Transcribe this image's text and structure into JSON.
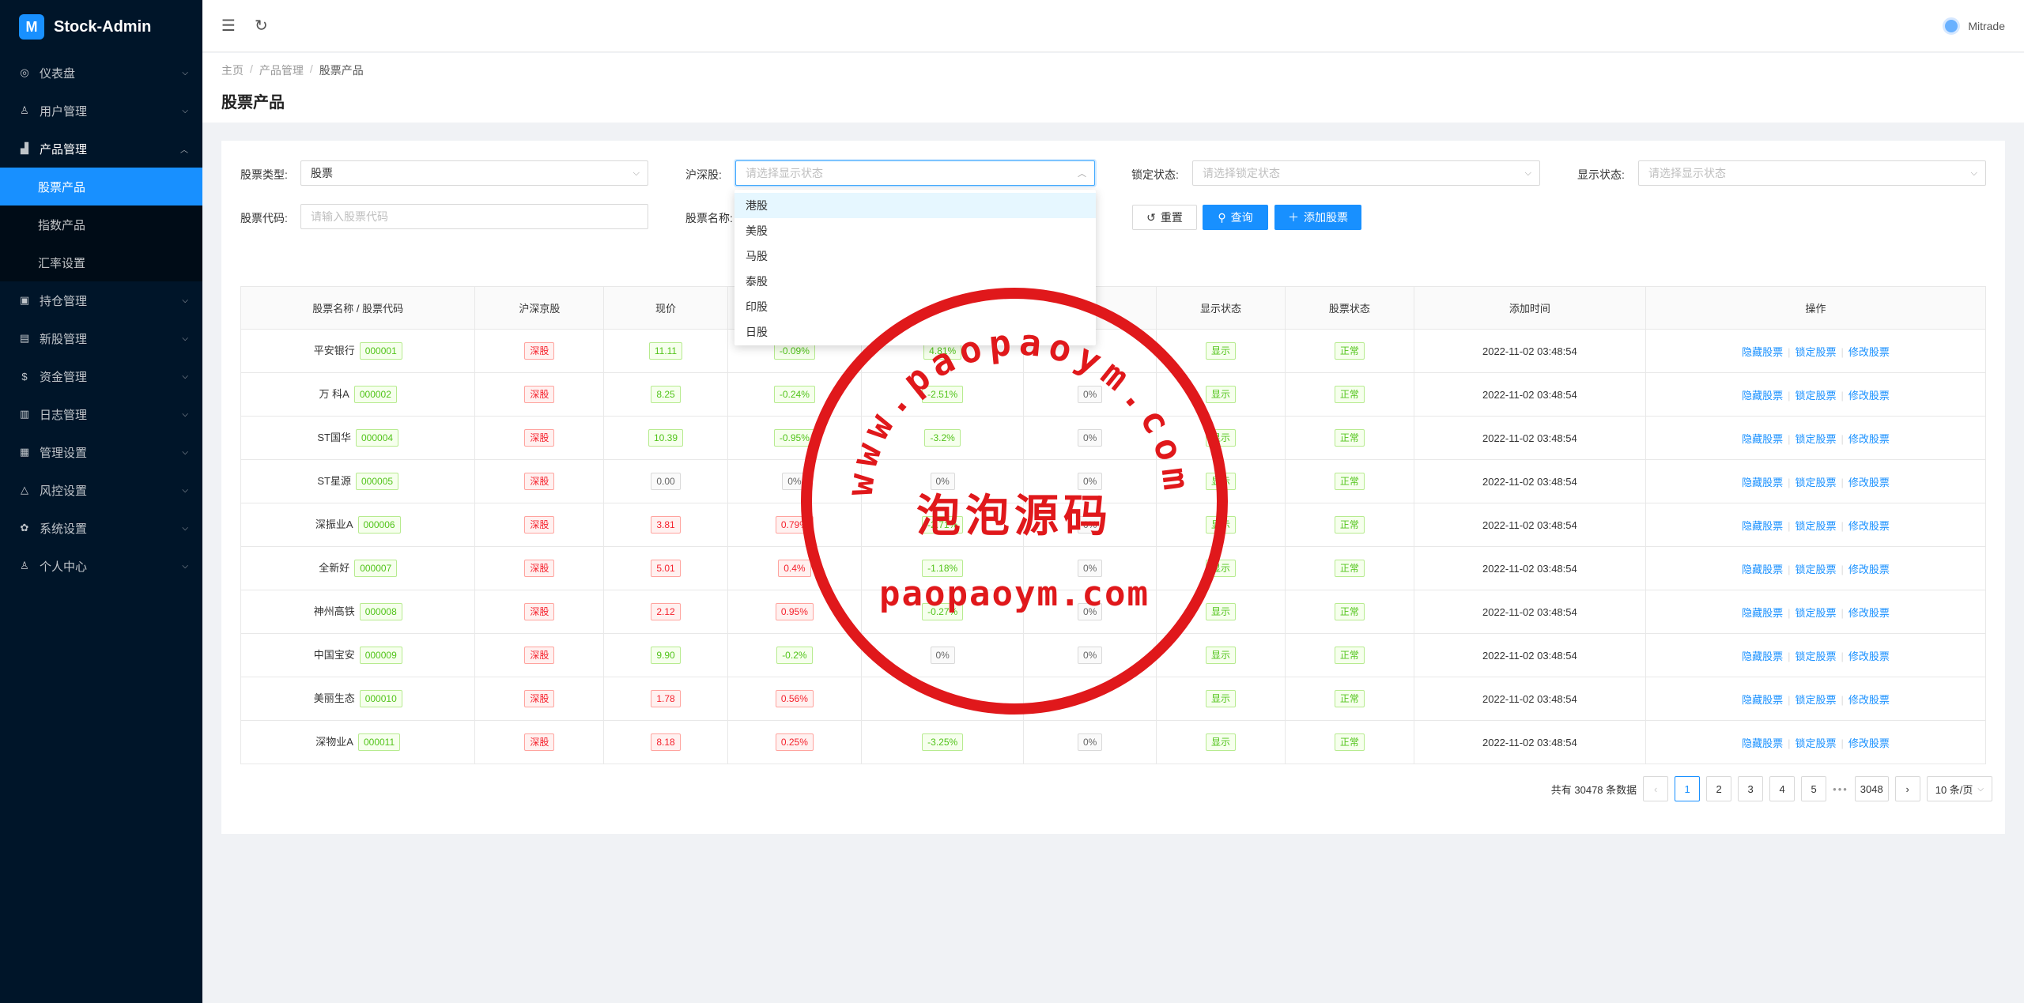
{
  "app": {
    "logo_letter": "M",
    "name": "Stock-Admin"
  },
  "sidebar": {
    "items": [
      {
        "icon": "dashboard-icon",
        "glyph": "◎",
        "label": "仪表盘"
      },
      {
        "icon": "users-icon",
        "glyph": "♙",
        "label": "用户管理"
      },
      {
        "icon": "chart-icon",
        "glyph": "▟",
        "label": "产品管理",
        "open": true
      },
      {
        "icon": "holdings-icon",
        "glyph": "▣",
        "label": "持仓管理"
      },
      {
        "icon": "ipo-icon",
        "glyph": "▤",
        "label": "新股管理"
      },
      {
        "icon": "funds-icon",
        "glyph": "$",
        "label": "资金管理"
      },
      {
        "icon": "log-icon",
        "glyph": "▥",
        "label": "日志管理"
      },
      {
        "icon": "admin-icon",
        "glyph": "▦",
        "label": "管理设置"
      },
      {
        "icon": "risk-icon",
        "glyph": "△",
        "label": "风控设置"
      },
      {
        "icon": "settings-icon",
        "glyph": "✿",
        "label": "系统设置"
      },
      {
        "icon": "profile-icon",
        "glyph": "♙",
        "label": "个人中心"
      }
    ],
    "sub_items": [
      "股票产品",
      "指数产品",
      "汇率设置"
    ]
  },
  "header": {
    "user": "Mitrade"
  },
  "breadcrumb": [
    "主页",
    "产品管理",
    "股票产品"
  ],
  "page_title": "股票产品",
  "filters": {
    "stock_type_label": "股票类型:",
    "stock_type_value": "股票",
    "market_label": "沪深股:",
    "market_placeholder": "请选择显示状态",
    "lock_label": "锁定状态:",
    "lock_placeholder": "请选择锁定状态",
    "display_label": "显示状态:",
    "display_placeholder": "请选择显示状态",
    "code_label": "股票代码:",
    "code_placeholder": "请输入股票代码",
    "name_label": "股票名称:",
    "reset": "重置",
    "search": "查询",
    "add": "添加股票"
  },
  "dropdown_options": [
    "港股",
    "美股",
    "马股",
    "泰股",
    "印股",
    "日股"
  ],
  "table": {
    "headers": [
      "股票名称 / 股票代码",
      "沪深京股",
      "现价",
      "",
      "",
      "率",
      "显示状态",
      "股票状态",
      "添加时间",
      "操作"
    ],
    "actions": [
      "隐藏股票",
      "锁定股票",
      "修改股票"
    ],
    "rows": [
      {
        "name": "平安银行",
        "code": "000001",
        "market": "深股",
        "price": "11.11",
        "price_c": "green",
        "c1": "-0.09%",
        "c1_c": "green",
        "c2": "4.81%",
        "c2_c": "green",
        "c3": "",
        "show": "显示",
        "status": "正常",
        "time": "2022-11-02 03:48:54"
      },
      {
        "name": "万 科A",
        "code": "000002",
        "market": "深股",
        "price": "8.25",
        "price_c": "green",
        "c1": "-0.24%",
        "c1_c": "green",
        "c2": "-2.51%",
        "c2_c": "green",
        "c3": "0%",
        "show": "显示",
        "status": "正常",
        "time": "2022-11-02 03:48:54"
      },
      {
        "name": "ST国华",
        "code": "000004",
        "market": "深股",
        "price": "10.39",
        "price_c": "green",
        "c1": "-0.95%",
        "c1_c": "green",
        "c2": "-3.2%",
        "c2_c": "green",
        "c3": "0%",
        "show": "显示",
        "status": "正常",
        "time": "2022-11-02 03:48:54"
      },
      {
        "name": "ST星源",
        "code": "000005",
        "market": "深股",
        "price": "0.00",
        "price_c": "grey",
        "c1": "0%",
        "c1_c": "grey",
        "c2": "0%",
        "c2_c": "grey",
        "c3": "0%",
        "show": "显示",
        "status": "正常",
        "time": "2022-11-02 03:48:54"
      },
      {
        "name": "深振业A",
        "code": "000006",
        "market": "深股",
        "price": "3.81",
        "price_c": "red",
        "c1": "0.79%",
        "c1_c": "red",
        "c2": "-2.71%",
        "c2_c": "green",
        "c3": "0%",
        "show": "显示",
        "status": "正常",
        "time": "2022-11-02 03:48:54"
      },
      {
        "name": "全新好",
        "code": "000007",
        "market": "深股",
        "price": "5.01",
        "price_c": "red",
        "c1": "0.4%",
        "c1_c": "red",
        "c2": "-1.18%",
        "c2_c": "green",
        "c3": "0%",
        "show": "显示",
        "status": "正常",
        "time": "2022-11-02 03:48:54"
      },
      {
        "name": "神州高铁",
        "code": "000008",
        "market": "深股",
        "price": "2.12",
        "price_c": "red",
        "c1": "0.95%",
        "c1_c": "red",
        "c2": "-0.27%",
        "c2_c": "green",
        "c3": "0%",
        "show": "显示",
        "status": "正常",
        "time": "2022-11-02 03:48:54"
      },
      {
        "name": "中国宝安",
        "code": "000009",
        "market": "深股",
        "price": "9.90",
        "price_c": "green",
        "c1": "-0.2%",
        "c1_c": "green",
        "c2": "0%",
        "c2_c": "grey",
        "c3": "0%",
        "show": "显示",
        "status": "正常",
        "time": "2022-11-02 03:48:54"
      },
      {
        "name": "美丽生态",
        "code": "000010",
        "market": "深股",
        "price": "1.78",
        "price_c": "red",
        "c1": "0.56%",
        "c1_c": "red",
        "c2": "",
        "c2_c": "green",
        "c3": "",
        "show": "显示",
        "status": "正常",
        "time": "2022-11-02 03:48:54"
      },
      {
        "name": "深物业A",
        "code": "000011",
        "market": "深股",
        "price": "8.18",
        "price_c": "red",
        "c1": "0.25%",
        "c1_c": "red",
        "c2": "-3.25%",
        "c2_c": "green",
        "c3": "0%",
        "show": "显示",
        "status": "正常",
        "time": "2022-11-02 03:48:54"
      }
    ]
  },
  "pagination": {
    "total_text": "共有 30478 条数据",
    "pages": [
      "1",
      "2",
      "3",
      "4",
      "5"
    ],
    "ellipsis": "•••",
    "last": "3048",
    "page_size": "10 条/页"
  },
  "watermark": {
    "ring_text": "www.paopaoym.com",
    "center": "泡泡源码",
    "bottom": "paopaoym.com",
    "color": "#e0181b"
  },
  "colors": {
    "primary": "#1890ff",
    "sidebar_bg": "#001529"
  }
}
